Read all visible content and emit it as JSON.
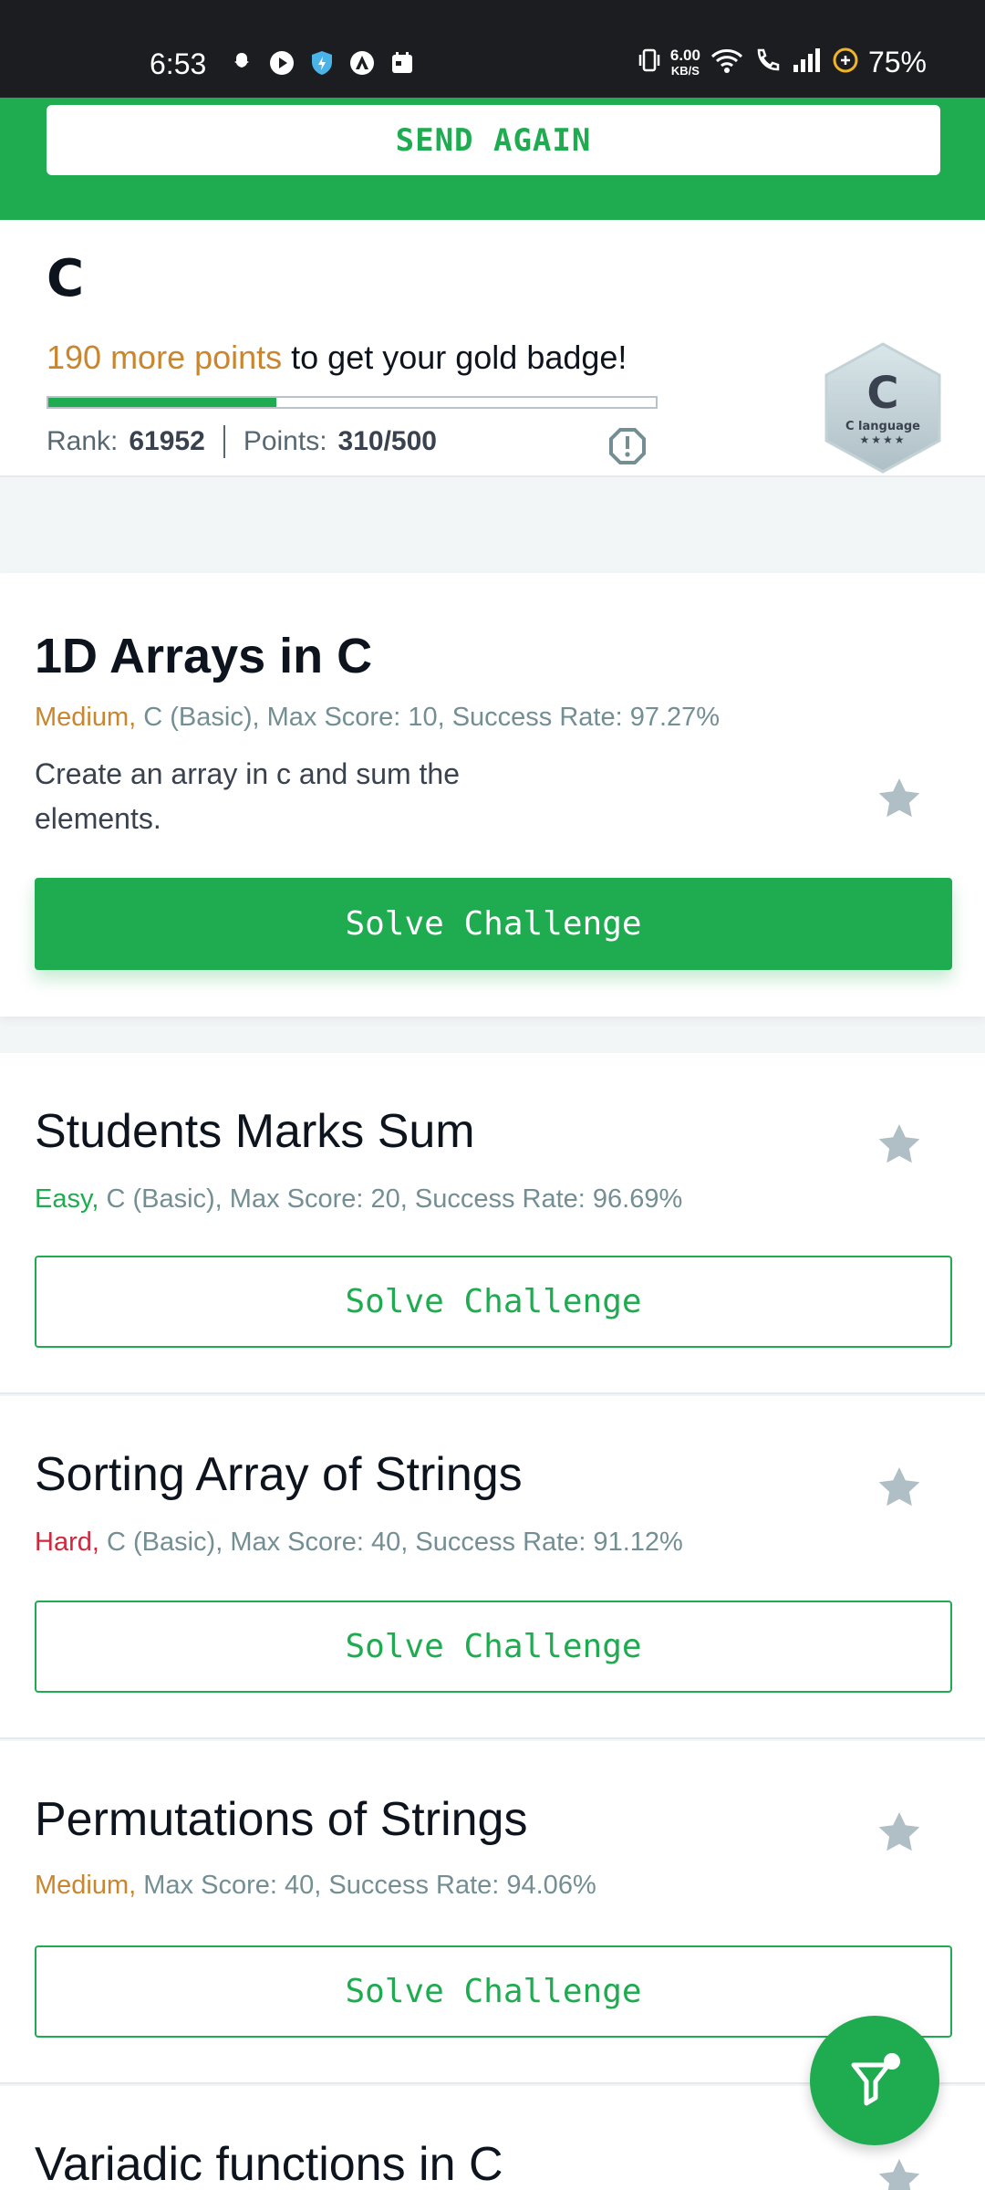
{
  "status_bar": {
    "time": "6:53",
    "net_speed_value": "6.00",
    "net_speed_unit": "KB/S",
    "battery": "75%",
    "icons_left": [
      "snapchat-icon",
      "play-icon",
      "shield-icon",
      "app-icon",
      "calendar-icon"
    ],
    "icons_right": [
      "vibrate-icon",
      "wifi-icon",
      "call-icon",
      "signal-icon",
      "battery-saver-icon"
    ]
  },
  "banner": {
    "send_again_label": "SEND AGAIN"
  },
  "track": {
    "title": "C",
    "points_needed": "190 more points",
    "points_message_rest": " to get your gold badge!",
    "progress_fraction": 0.375,
    "rank_label": "Rank:",
    "rank_value": "61952",
    "points_label": "Points:",
    "points_value": "310/500",
    "badge_letter": "C",
    "badge_label": "C language",
    "badge_stars": "★★★★"
  },
  "challenges": [
    {
      "title": "1D Arrays in C",
      "difficulty": "Medium,",
      "meta": " C (Basic), Max Score: 10, Success Rate: 97.27%",
      "description": "Create an array in c and sum the elements.",
      "button": "Solve Challenge"
    },
    {
      "title": "Students Marks Sum",
      "difficulty": "Easy,",
      "meta": " C (Basic), Max Score: 20, Success Rate: 96.69%",
      "button": "Solve Challenge"
    },
    {
      "title": "Sorting Array of Strings",
      "difficulty": "Hard,",
      "meta": " C (Basic), Max Score: 40, Success Rate: 91.12%",
      "button": "Solve Challenge"
    },
    {
      "title": "Permutations of Strings",
      "difficulty": "Medium,",
      "meta": " Max Score: 40, Success Rate: 94.06%",
      "button": "Solve Challenge"
    },
    {
      "title": "Variadic functions in C"
    }
  ],
  "colors": {
    "brand_green": "#1fab50",
    "medium": "#c9862e",
    "easy": "#1fab50",
    "hard": "#d0273c"
  }
}
